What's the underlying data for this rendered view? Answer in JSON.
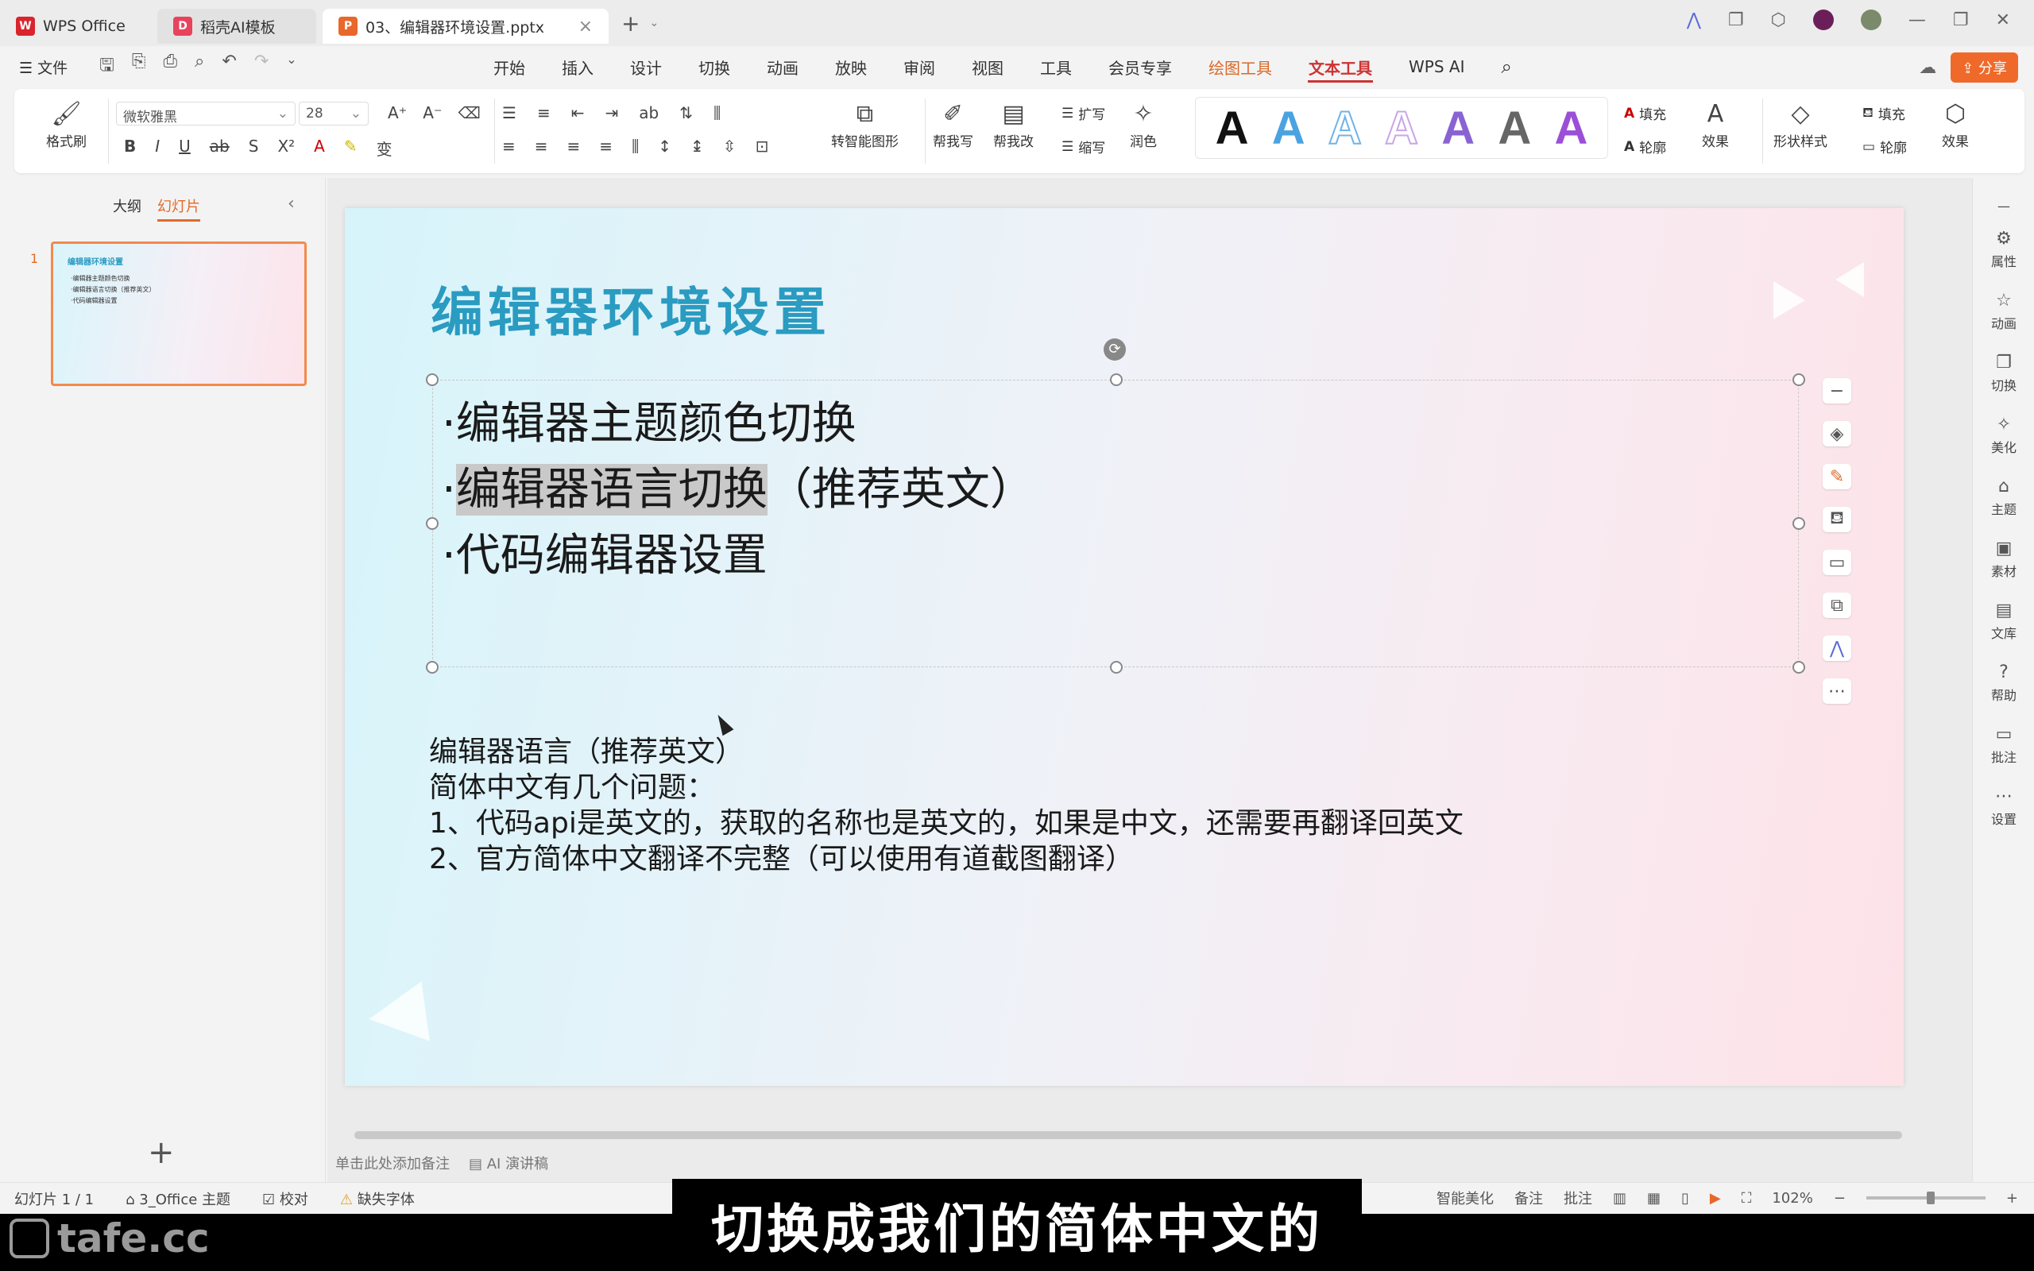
{
  "titlebar": {
    "tabs": [
      {
        "label": "WPS Office",
        "icon": "wps-logo-icon",
        "color": "#d9242d"
      },
      {
        "label": "稻壳AI模板",
        "icon": "docer-logo-icon",
        "color": "#e8425c"
      },
      {
        "label": "03、编辑器环境设置.pptx",
        "icon": "pptx-file-icon",
        "color": "#e8672a"
      }
    ],
    "new_tab": "+",
    "tab_menu": "⌄"
  },
  "menubar": {
    "file_label": "☰ 文件",
    "tabs": [
      "开始",
      "插入",
      "设计",
      "切换",
      "动画",
      "放映",
      "审阅",
      "视图",
      "工具",
      "会员专享",
      "绘图工具",
      "文本工具",
      "WPS AI"
    ],
    "active_tab": "文本工具",
    "share_label": "分享"
  },
  "ribbon": {
    "format_painter": "格式刷",
    "font_name": "微软雅黑",
    "font_size": "28",
    "smart_shape": "转智能图形",
    "help_write": "帮我写",
    "help_edit": "帮我改",
    "expand": "扩写",
    "shrink": "缩写",
    "polish": "润色",
    "fill": "填充",
    "outline": "轮廓",
    "effect": "效果",
    "shape_style": "形状样式",
    "shape_fill": "填充",
    "shape_outline": "轮廓",
    "shape_effect": "效果",
    "text_styles": [
      {
        "glyph": "A",
        "color": "#111111"
      },
      {
        "glyph": "A",
        "color": "#4aa3e0"
      },
      {
        "glyph": "A",
        "color": "#6fb4e8"
      },
      {
        "glyph": "A",
        "color": "#c9a6e8"
      },
      {
        "glyph": "A",
        "color": "#8a63d2"
      },
      {
        "glyph": "A",
        "color": "#666666"
      },
      {
        "glyph": "A",
        "color": "#9b4fd6"
      }
    ]
  },
  "leftpanel": {
    "tab_outline": "大纲",
    "tab_slides": "幻灯片",
    "slide_number": "1",
    "thumb_title": "编辑器环境设置",
    "thumb_lines": [
      "·编辑器主题颜色切换",
      "·编辑器语言切换（推荐英文）",
      "·代码编辑器设置"
    ],
    "add_slide": "+"
  },
  "slide": {
    "title": "编辑器环境设置",
    "bullets": {
      "b1": "·编辑器主题颜色切换",
      "b2_dot": "·",
      "b2_sel": "编辑器语言切换",
      "b2_rest": "（推荐英文）",
      "b3": "·代码编辑器设置"
    },
    "notes": [
      "编辑器语言（推荐英文）",
      "简体中文有几个问题：",
      "1、代码api是英文的，获取的名称也是英文的，如果是中文，还需要再翻译回英文",
      "2、官方简体中文翻译不完整（可以使用有道截图翻译）"
    ]
  },
  "notebar": {
    "placeholder": "单击此处添加备注",
    "ai_script": "AI 演讲稿"
  },
  "rightbar": {
    "items": [
      "属性",
      "动画",
      "切换",
      "美化",
      "主题",
      "素材",
      "文库",
      "帮助",
      "批注",
      "设置"
    ]
  },
  "statusbar": {
    "slide_count": "幻灯片 1 / 1",
    "theme": "3_Office 主题",
    "proofread": "校对",
    "missing_font": "缺失字体",
    "smart_beautify": "智能美化",
    "notes": "备注",
    "comments": "批注",
    "zoom": "102%"
  },
  "caption": "切换成我们的简体中文的",
  "watermark": "tafe.cc"
}
